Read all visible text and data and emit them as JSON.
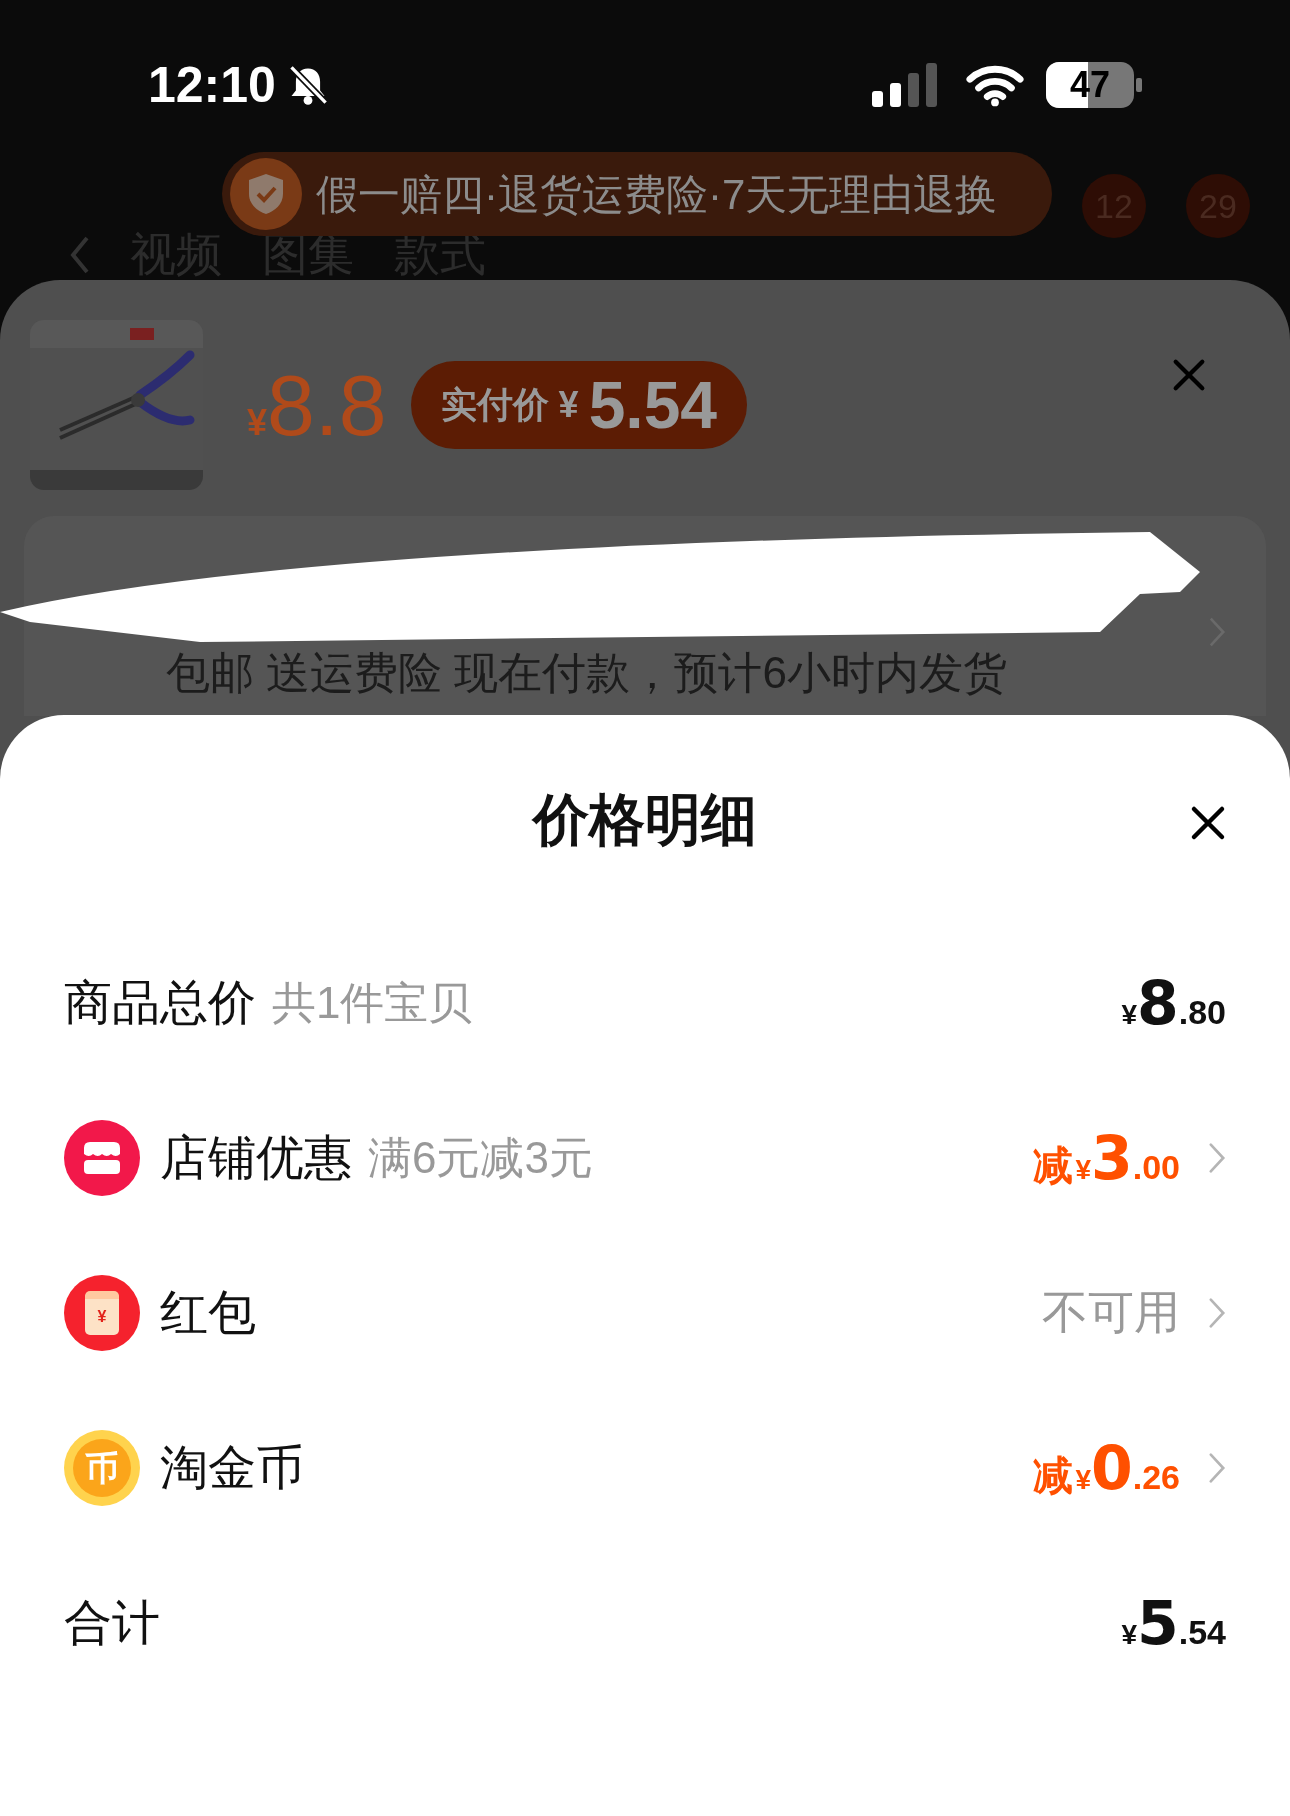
{
  "status_bar": {
    "time": "12:10",
    "silent": true,
    "battery": "47"
  },
  "background_page": {
    "banner": "假一赔四·退货运费险·7天无理由退换",
    "nav_tabs": [
      "视频",
      "图集",
      "款式"
    ],
    "badges": [
      "12",
      "29"
    ],
    "product": {
      "price_currency": "¥",
      "price": "8.8",
      "paid_label": "实付价",
      "paid_currency": "¥",
      "paid_price": "5.54"
    },
    "shipping_note": "包邮 送运费险 现在付款，预计6小时内发货"
  },
  "sheet": {
    "title": "价格明细",
    "rows": [
      {
        "kind": "plain",
        "label": "商品总价",
        "note": "共1件宝贝",
        "value": {
          "currency": "¥",
          "integer": "8",
          "decimal": ".80"
        },
        "highlight": false,
        "chevron": false
      },
      {
        "kind": "shop",
        "label": "店铺优惠",
        "note": "满6元减3元",
        "value": {
          "prefix": "减",
          "currency": "¥",
          "integer": "3",
          "decimal": ".00"
        },
        "highlight": true,
        "chevron": true
      },
      {
        "kind": "envelope",
        "icon_glyph": "¥",
        "label": "红包",
        "status": "不可用",
        "chevron": true
      },
      {
        "kind": "coin",
        "icon_glyph": "币",
        "label": "淘金币",
        "value": {
          "prefix": "减",
          "currency": "¥",
          "integer": "0",
          "decimal": ".26"
        },
        "highlight": true,
        "chevron": true
      },
      {
        "kind": "plain",
        "label": "合计",
        "value": {
          "currency": "¥",
          "integer": "5",
          "decimal": ".54"
        },
        "highlight": false,
        "chevron": false
      }
    ]
  }
}
